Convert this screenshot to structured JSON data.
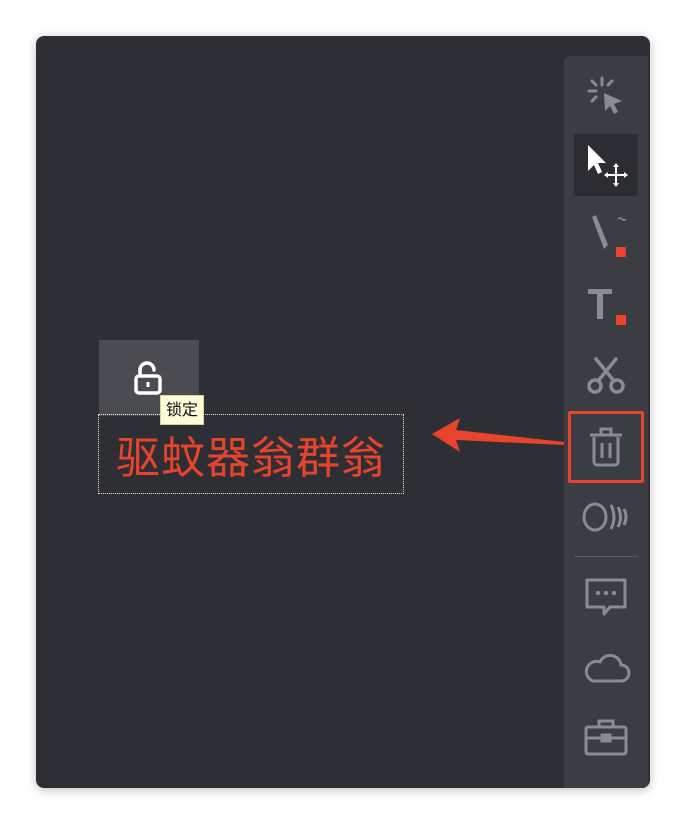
{
  "canvas": {
    "lock_tooltip": "锁定",
    "text_content": "驱蚊器翁群翁"
  },
  "toolbar": {
    "tools": [
      {
        "name": "magic-select",
        "icon": "magic-cursor-icon",
        "active": false
      },
      {
        "name": "select-move",
        "icon": "move-cursor-icon",
        "active": true
      },
      {
        "name": "pen",
        "icon": "pen-icon",
        "active": false
      },
      {
        "name": "text",
        "icon": "text-icon",
        "active": false
      },
      {
        "name": "cut",
        "icon": "scissors-icon",
        "active": false
      },
      {
        "name": "delete",
        "icon": "trash-icon",
        "active": false,
        "highlighted": true
      },
      {
        "name": "sound",
        "icon": "sound-wave-icon",
        "active": false
      },
      {
        "name": "comment",
        "icon": "chat-bubble-icon",
        "active": false
      },
      {
        "name": "cloud",
        "icon": "cloud-icon",
        "active": false
      },
      {
        "name": "toolbox",
        "icon": "toolbox-icon",
        "active": false
      }
    ]
  },
  "colors": {
    "accent": "#e8432c",
    "background": "#2d2f35",
    "toolbar": "#3b3d43",
    "icon": "#8a8c91"
  }
}
